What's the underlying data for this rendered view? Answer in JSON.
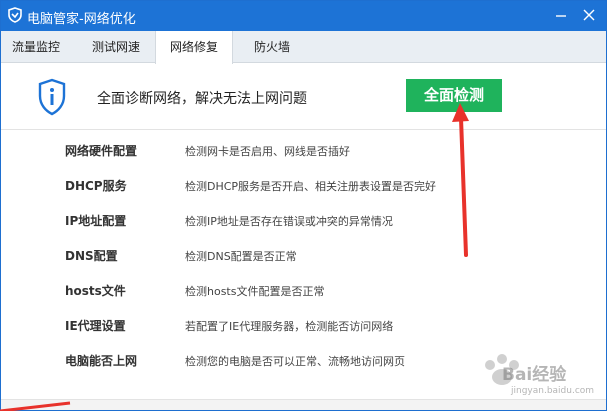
{
  "window": {
    "title": "电脑管家-网络优化",
    "accent_color": "#1d73d6",
    "minimize_icon": "minimize-icon",
    "close_icon": "close-icon"
  },
  "tabs": [
    {
      "label": "流量监控",
      "active": false
    },
    {
      "label": "测试网速",
      "active": false
    },
    {
      "label": "网络修复",
      "active": true
    },
    {
      "label": "防火墙",
      "active": false
    }
  ],
  "header": {
    "icon": "shield-info-icon",
    "text": "全面诊断网络，解决无法上网问题",
    "button_label": "全面检测",
    "button_color": "#1fb35c"
  },
  "checks": [
    {
      "name": "网络硬件配置",
      "desc": "检测网卡是否启用、网线是否插好"
    },
    {
      "name": "DHCP服务",
      "desc": "检测DHCP服务是否开启、相关注册表设置是否完好"
    },
    {
      "name": "IP地址配置",
      "desc": "检测IP地址是否存在错误或冲突的异常情况"
    },
    {
      "name": "DNS配置",
      "desc": "检测DNS配置是否正常"
    },
    {
      "name": "hosts文件",
      "desc": "检测hosts文件配置是否正常"
    },
    {
      "name": "IE代理设置",
      "desc": "若配置了IE代理服务器，检测能否访问网络"
    },
    {
      "name": "电脑能否上网",
      "desc": "检测您的电脑是否可以正常、流畅地访问网页"
    }
  ],
  "annotation": {
    "color": "#e8322b"
  },
  "watermark": {
    "text": "Bai经验",
    "url": "jingyan.baidu.com"
  }
}
